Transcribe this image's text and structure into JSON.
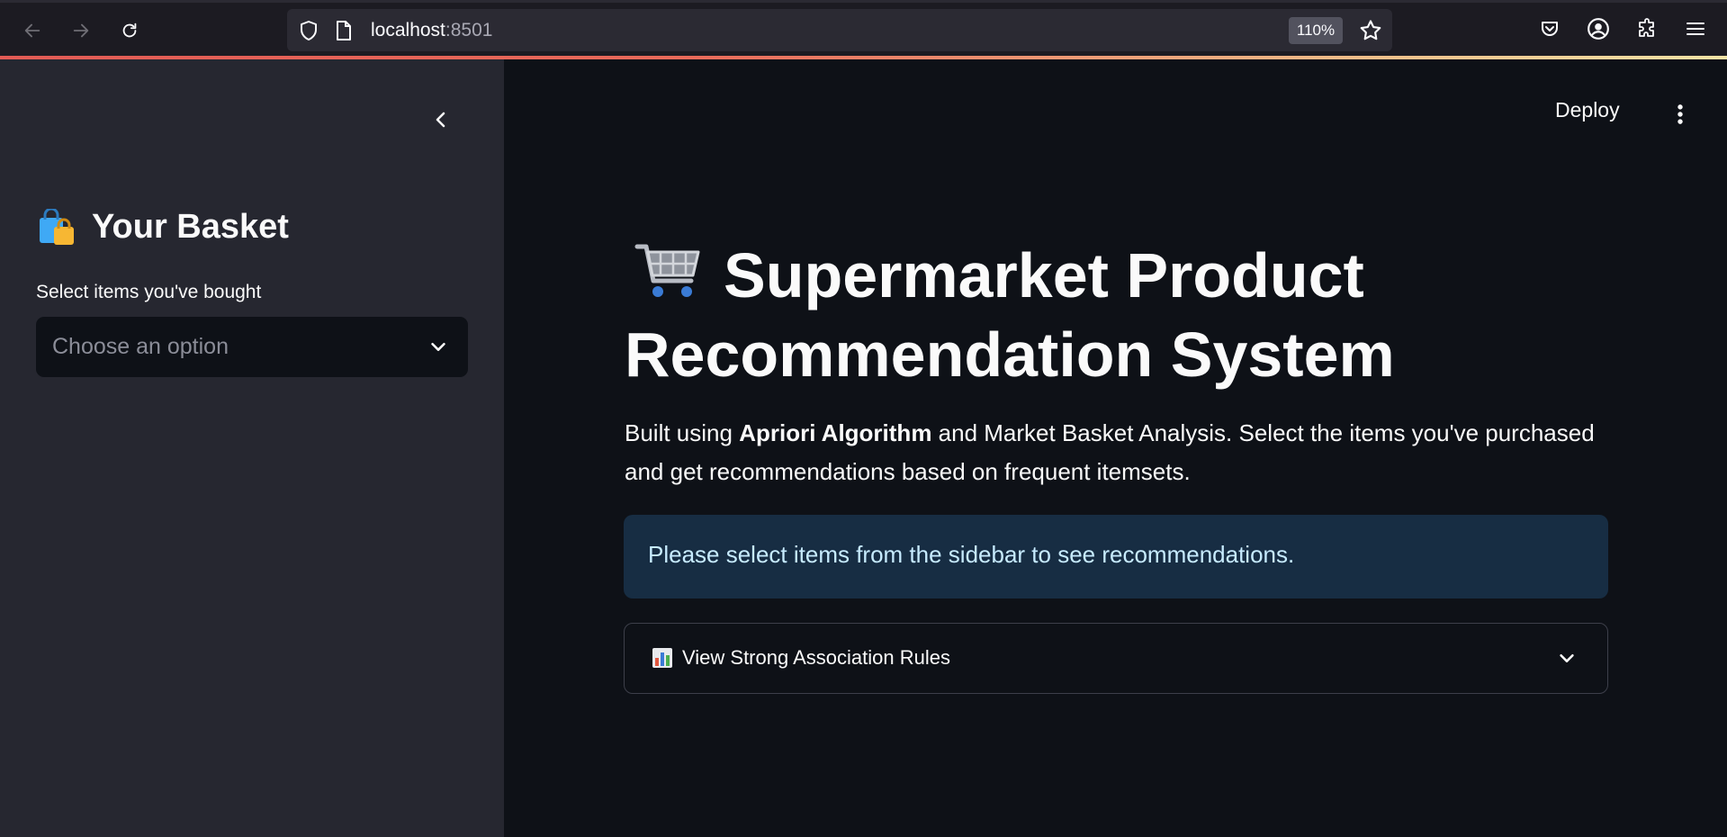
{
  "browser": {
    "url_host": "localhost",
    "url_port": ":8501",
    "zoom": "110%"
  },
  "sidebar": {
    "title": "Your Basket",
    "select_label": "Select items you've bought",
    "select_placeholder": "Choose an option"
  },
  "header": {
    "deploy_label": "Deploy"
  },
  "main": {
    "title": "Supermarket Product Recommendation System",
    "description_prefix": "Built using ",
    "description_bold": "Apriori Algorithm",
    "description_suffix": " and Market Basket Analysis. Select the items you've purchased and get recommendations based on frequent itemsets.",
    "info_message": "Please select items from the sidebar to see recommendations.",
    "expander_label": "View Strong Association Rules"
  },
  "colors": {
    "sidebar_bg": "#262730",
    "main_bg": "#0e1117",
    "info_bg": "#172d43",
    "info_text": "#c7ebff"
  }
}
